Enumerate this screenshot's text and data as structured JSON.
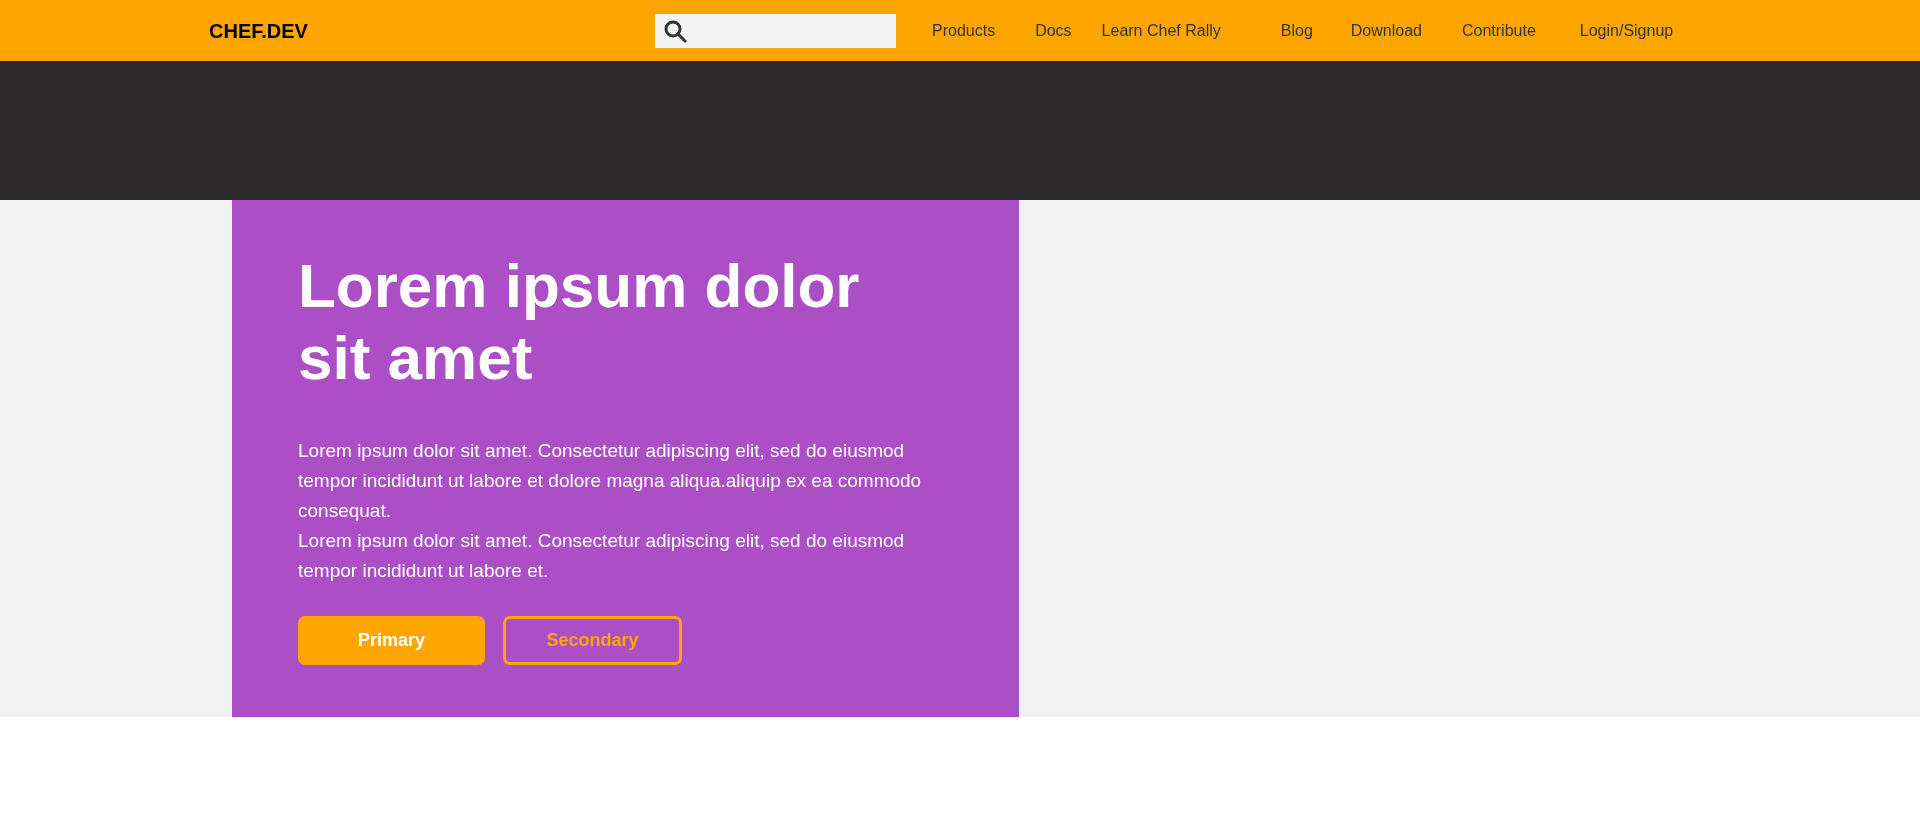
{
  "header": {
    "logo": "CHEF.DEV",
    "nav": [
      {
        "label": "Products"
      },
      {
        "label": "Docs"
      },
      {
        "label": "Learn Chef Rally"
      },
      {
        "label": "Blog"
      },
      {
        "label": "Download"
      },
      {
        "label": "Contribute"
      },
      {
        "label": "Login/Signup"
      }
    ]
  },
  "hero": {
    "title": "Lorem ipsum dolor sit amet",
    "paragraphs": [
      "Lorem ipsum dolor sit amet. Consectetur adipiscing elit, sed do eiusmod tempor incididunt ut labore et dolore magna aliqua.aliquip ex ea commodo consequat.",
      "Lorem ipsum dolor sit amet. Consectetur adipiscing elit, sed do eiusmod tempor incididunt ut labore et."
    ],
    "buttons": [
      {
        "label": "Primary",
        "kind": "primary"
      },
      {
        "label": "Secondary",
        "kind": "secondary"
      }
    ]
  }
}
